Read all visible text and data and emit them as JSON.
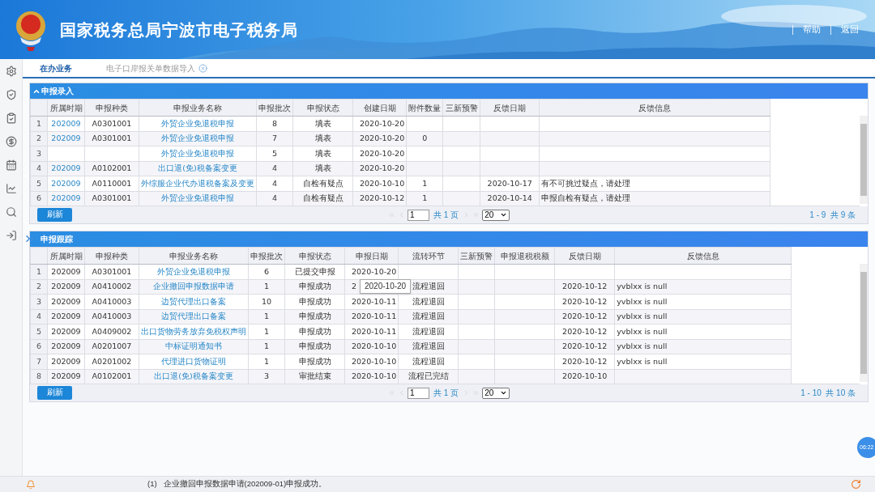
{
  "header": {
    "title": "国家税务总局宁波市电子税务局",
    "links": [
      "帮助",
      "返回"
    ]
  },
  "tabs": [
    {
      "label": "在办业务",
      "selected": true,
      "closable": false
    },
    {
      "label": "电子口岸报关单数据导入",
      "selected": false,
      "closable": true
    }
  ],
  "panels": [
    {
      "title": "申报录入",
      "collapsible": true,
      "columns": [
        {
          "kind": "index"
        },
        {
          "label": "所属时期",
          "kind": "link"
        },
        {
          "label": "申报种类",
          "kind": "text"
        },
        {
          "label": "申报业务名称",
          "kind": "link"
        },
        {
          "label": "申报批次",
          "kind": "text"
        },
        {
          "label": "申报状态",
          "kind": "text"
        },
        {
          "label": "创建日期",
          "kind": "text"
        },
        {
          "label": "附件数量",
          "kind": "text"
        },
        {
          "label": "三新预警",
          "kind": "text"
        },
        {
          "label": "反馈日期",
          "kind": "text"
        },
        {
          "label": "反馈信息",
          "kind": "text"
        }
      ],
      "rows": [
        [
          "1",
          "202009",
          "A0301001",
          "外贸企业免退税申报",
          "8",
          "填表",
          "2020-10-20",
          "",
          "",
          "",
          ""
        ],
        [
          "2",
          "202009",
          "A0301001",
          "外贸企业免退税申报",
          "7",
          "填表",
          "2020-10-20",
          "0",
          "",
          "",
          ""
        ],
        [
          "3",
          "",
          "",
          "外贸企业免退税申报",
          "5",
          "填表",
          "2020-10-20",
          "",
          "",
          "",
          ""
        ],
        [
          "4",
          "202009",
          "A0102001",
          "出口退(免)税备案变更",
          "4",
          "填表",
          "2020-10-20",
          "",
          "",
          "",
          ""
        ],
        [
          "5",
          "202009",
          "A0110001",
          "外综服企业代办退税备案及变更",
          "4",
          "自检有疑点",
          "2020-10-10",
          "1",
          "",
          "2020-10-17",
          "有不可挑过疑点，请处理"
        ],
        [
          "6",
          "202009",
          "A0301001",
          "外贸企业免退税申报",
          "4",
          "自检有疑点",
          "2020-10-12",
          "1",
          "",
          "2020-10-14",
          "申报自检有疑点，请处理"
        ]
      ],
      "footer": {
        "refresh": "刷新",
        "page_input": "1",
        "page_text": "共 1 页",
        "page_size": "20",
        "summary": "1 - 9  共 9 条"
      }
    },
    {
      "title": "申报跟踪",
      "collapsible": false,
      "columns": [
        {
          "kind": "index"
        },
        {
          "label": "所属时期",
          "kind": "text"
        },
        {
          "label": "申报种类",
          "kind": "text"
        },
        {
          "label": "申报业务名称",
          "kind": "link"
        },
        {
          "label": "申报批次",
          "kind": "text"
        },
        {
          "label": "申报状态",
          "kind": "text"
        },
        {
          "label": "申报日期",
          "kind": "text"
        },
        {
          "label": "流转环节",
          "kind": "text"
        },
        {
          "label": "三新预警",
          "kind": "text"
        },
        {
          "label": "申报退税税额",
          "kind": "text"
        },
        {
          "label": "反馈日期",
          "kind": "text"
        },
        {
          "label": "反馈信息",
          "kind": "text"
        }
      ],
      "rows": [
        [
          "1",
          "202009",
          "A0301001",
          "外贸企业免退税申报",
          "6",
          "已提交申报",
          "2020-10-20",
          "",
          "",
          "",
          "",
          ""
        ],
        [
          "2",
          "202009",
          "A0410002",
          "企业撤回申报数据申请",
          "1",
          "申报成功",
          "2",
          "流程退回",
          "",
          "",
          "2020-10-12",
          "yvblxx is null"
        ],
        [
          "3",
          "202009",
          "A0410003",
          "边贸代理出口备案",
          "10",
          "申报成功",
          "2020-10-11",
          "流程退回",
          "",
          "",
          "2020-10-12",
          "yvblxx is null"
        ],
        [
          "4",
          "202009",
          "A0410003",
          "边贸代理出口备案",
          "1",
          "申报成功",
          "2020-10-11",
          "流程退回",
          "",
          "",
          "2020-10-12",
          "yvblxx is null"
        ],
        [
          "5",
          "202009",
          "A0409002",
          "出口货物劳务放弃免税权声明",
          "1",
          "申报成功",
          "2020-10-11",
          "流程退回",
          "",
          "",
          "2020-10-12",
          "yvblxx is null"
        ],
        [
          "6",
          "202009",
          "A0201007",
          "中标证明通知书",
          "1",
          "申报成功",
          "2020-10-10",
          "流程退回",
          "",
          "",
          "2020-10-12",
          "yvblxx is null"
        ],
        [
          "7",
          "202009",
          "A0201002",
          "代理进口货物证明",
          "1",
          "申报成功",
          "2020-10-10",
          "流程退回",
          "",
          "",
          "2020-10-12",
          "yvblxx is null"
        ],
        [
          "8",
          "202009",
          "A0102001",
          "出口退(免)税备案变更",
          "3",
          "审批结束",
          "2020-10-10",
          "流程已完结",
          "",
          "",
          "2020-10-10",
          ""
        ]
      ],
      "tooltip": "2020-10-20",
      "footer": {
        "refresh": "刷新",
        "page_input": "1",
        "page_text": "共 1 页",
        "page_size": "20",
        "summary": "1 - 10  共 10 条"
      }
    }
  ],
  "status_bar": {
    "message": "(1)   企业撤回申报数据申请(202009-01)申报成功。",
    "clock_badge": "06:22"
  }
}
